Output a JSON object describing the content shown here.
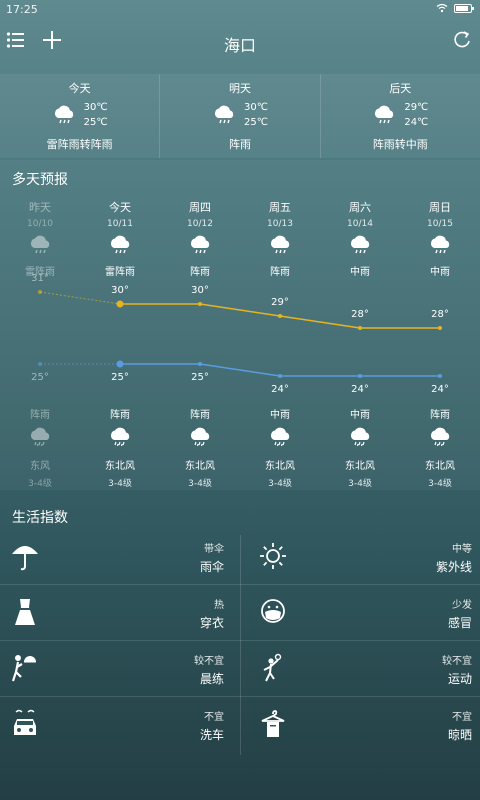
{
  "status": {
    "time": "17:25"
  },
  "header": {
    "city": "海口"
  },
  "three_days": [
    {
      "label": "今天",
      "high": "30℃",
      "low": "25℃",
      "cond": "雷阵雨转阵雨"
    },
    {
      "label": "明天",
      "high": "30℃",
      "low": "25℃",
      "cond": "阵雨"
    },
    {
      "label": "后天",
      "high": "29℃",
      "low": "24℃",
      "cond": "阵雨转中雨"
    }
  ],
  "forecast": {
    "title": "多天预报",
    "days": [
      {
        "name": "昨天",
        "date": "10/10",
        "day_cond": "雷阵雨",
        "high": "31°",
        "low": "25°",
        "night_cond": "阵雨",
        "wind": "东风",
        "level": "3-4级"
      },
      {
        "name": "今天",
        "date": "10/11",
        "day_cond": "雷阵雨",
        "high": "30°",
        "low": "25°",
        "night_cond": "阵雨",
        "wind": "东北风",
        "level": "3-4级"
      },
      {
        "name": "周四",
        "date": "10/12",
        "day_cond": "阵雨",
        "high": "30°",
        "low": "25°",
        "night_cond": "阵雨",
        "wind": "东北风",
        "level": "3-4级"
      },
      {
        "name": "周五",
        "date": "10/13",
        "day_cond": "阵雨",
        "high": "29°",
        "low": "24°",
        "night_cond": "中雨",
        "wind": "东北风",
        "level": "3-4级"
      },
      {
        "name": "周六",
        "date": "10/14",
        "day_cond": "中雨",
        "high": "28°",
        "low": "24°",
        "night_cond": "中雨",
        "wind": "东北风",
        "level": "3-4级"
      },
      {
        "name": "周日",
        "date": "10/15",
        "day_cond": "中雨",
        "high": "28°",
        "low": "24°",
        "night_cond": "阵雨",
        "wind": "东北风",
        "level": "3-4级"
      }
    ],
    "high_values": [
      31,
      30,
      30,
      29,
      28,
      28
    ],
    "low_values": [
      25,
      25,
      25,
      24,
      24,
      24
    ],
    "colors": {
      "high": "#e8b321",
      "low": "#5b9be0"
    }
  },
  "life": {
    "title": "生活指数",
    "items": [
      {
        "level": "带伞",
        "name": "雨伞",
        "icon": "umbrella-icon"
      },
      {
        "level": "中等",
        "name": "紫外线",
        "icon": "sun-icon"
      },
      {
        "level": "热",
        "name": "穿衣",
        "icon": "dress-icon"
      },
      {
        "level": "少发",
        "name": "感冒",
        "icon": "mask-icon"
      },
      {
        "level": "较不宜",
        "name": "晨练",
        "icon": "exercise-icon"
      },
      {
        "level": "较不宜",
        "name": "运动",
        "icon": "sport-icon"
      },
      {
        "level": "不宜",
        "name": "洗车",
        "icon": "car-wash-icon"
      },
      {
        "level": "不宜",
        "name": "晾晒",
        "icon": "hanger-icon"
      }
    ]
  }
}
